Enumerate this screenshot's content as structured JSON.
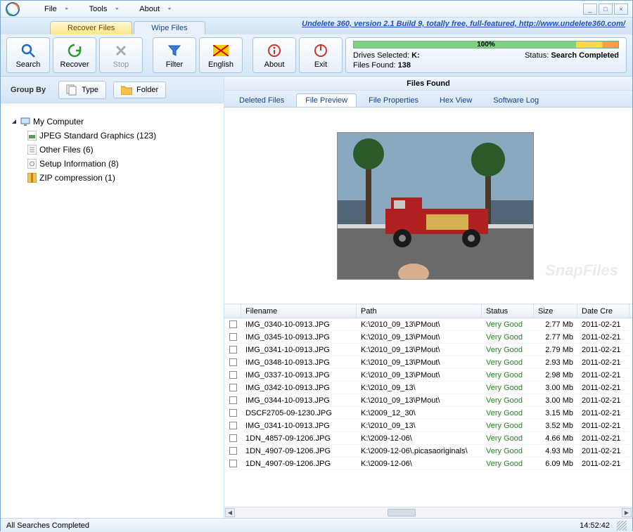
{
  "menu": {
    "file": "File",
    "tools": "Tools",
    "about": "About"
  },
  "window": {
    "min": "_",
    "max": "□",
    "close": "×"
  },
  "tabs": {
    "recover": "Recover Files",
    "wipe": "Wipe Files"
  },
  "banner": "Undelete 360, version 2.1 Build 9, totally free, full-featured, http://www.undelete360.com/",
  "toolbar": {
    "search": "Search",
    "recover": "Recover",
    "stop": "Stop",
    "filter": "Filter",
    "english": "English",
    "about": "About",
    "exit": "Exit"
  },
  "status": {
    "percent": "100%",
    "drives_lbl": "Drives Selected:",
    "drives_val": "K:",
    "files_lbl": "Files Found:",
    "files_val": "138",
    "status_lbl": "Status:",
    "status_val": "Search Completed"
  },
  "sidebar": {
    "group_by": "Group By",
    "type": "Type",
    "folder": "Folder"
  },
  "tree": {
    "root": "My Computer",
    "items": [
      "JPEG Standard Graphics (123)",
      "Other Files (6)",
      "Setup Information (8)",
      "ZIP compression (1)"
    ]
  },
  "main": {
    "files_found": "Files Found"
  },
  "subtabs": {
    "deleted": "Deleted Files",
    "preview": "File Preview",
    "properties": "File Properties",
    "hex": "Hex View",
    "log": "Software Log"
  },
  "columns": {
    "filename": "Filename",
    "path": "Path",
    "status": "Status",
    "size": "Size",
    "date": "Date Cre"
  },
  "rows": [
    {
      "name": "IMG_0340-10-0913.JPG",
      "path": "K:\\2010_09_13\\PMout\\",
      "status": "Very Good",
      "size": "2.77 Mb",
      "date": "2011-02-21"
    },
    {
      "name": "IMG_0345-10-0913.JPG",
      "path": "K:\\2010_09_13\\PMout\\",
      "status": "Very Good",
      "size": "2.77 Mb",
      "date": "2011-02-21"
    },
    {
      "name": "IMG_0341-10-0913.JPG",
      "path": "K:\\2010_09_13\\PMout\\",
      "status": "Very Good",
      "size": "2.79 Mb",
      "date": "2011-02-21"
    },
    {
      "name": "IMG_0348-10-0913.JPG",
      "path": "K:\\2010_09_13\\PMout\\",
      "status": "Very Good",
      "size": "2.93 Mb",
      "date": "2011-02-21"
    },
    {
      "name": "IMG_0337-10-0913.JPG",
      "path": "K:\\2010_09_13\\PMout\\",
      "status": "Very Good",
      "size": "2.98 Mb",
      "date": "2011-02-21"
    },
    {
      "name": "IMG_0342-10-0913.JPG",
      "path": "K:\\2010_09_13\\",
      "status": "Very Good",
      "size": "3.00 Mb",
      "date": "2011-02-21"
    },
    {
      "name": "IMG_0344-10-0913.JPG",
      "path": "K:\\2010_09_13\\PMout\\",
      "status": "Very Good",
      "size": "3.00 Mb",
      "date": "2011-02-21"
    },
    {
      "name": "DSCF2705-09-1230.JPG",
      "path": "K:\\2009_12_30\\",
      "status": "Very Good",
      "size": "3.15 Mb",
      "date": "2011-02-21"
    },
    {
      "name": "IMG_0341-10-0913.JPG",
      "path": "K:\\2010_09_13\\",
      "status": "Very Good",
      "size": "3.52 Mb",
      "date": "2011-02-21"
    },
    {
      "name": "1DN_4857-09-1206.JPG",
      "path": "K:\\2009-12-06\\",
      "status": "Very Good",
      "size": "4.66 Mb",
      "date": "2011-02-21"
    },
    {
      "name": "1DN_4907-09-1206.JPG",
      "path": "K:\\2009-12-06\\.picasaoriginals\\",
      "status": "Very Good",
      "size": "4.93 Mb",
      "date": "2011-02-21"
    },
    {
      "name": "1DN_4907-09-1206.JPG",
      "path": "K:\\2009-12-06\\",
      "status": "Very Good",
      "size": "6.09 Mb",
      "date": "2011-02-21"
    }
  ],
  "statusbar": {
    "left": "All Searches Completed",
    "time": "14:52:42"
  },
  "watermark": "SnapFiles"
}
